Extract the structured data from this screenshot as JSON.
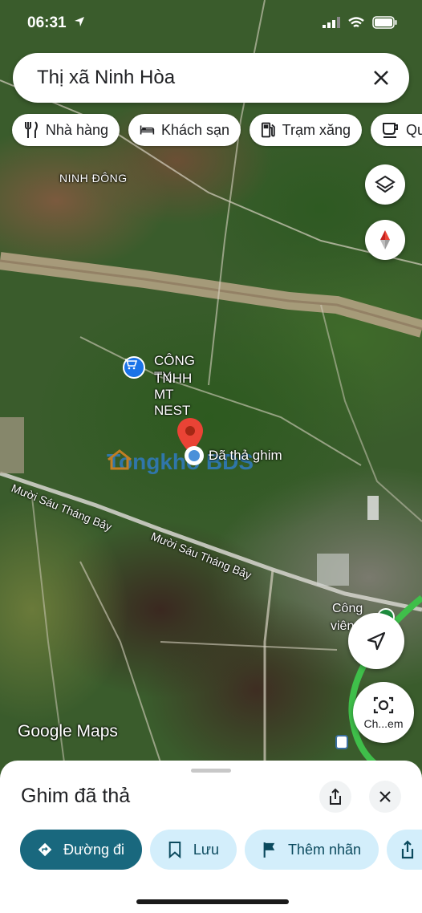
{
  "status_bar": {
    "time": "06:31"
  },
  "search": {
    "query": "Thị xã Ninh Hòa"
  },
  "chips": [
    {
      "label": "Nhà hàng",
      "icon": "fork-knife-icon"
    },
    {
      "label": "Khách sạn",
      "icon": "bed-icon"
    },
    {
      "label": "Trạm xăng",
      "icon": "gas-pump-icon"
    },
    {
      "label": "Qu",
      "icon": "coffee-cup-icon"
    }
  ],
  "map": {
    "labels": {
      "ninh_dong": "NINH ĐÔNG",
      "company_line1": "CÔNG TY",
      "company_line2": "TNHH MT NEST",
      "dropped_pin": "Đã thả ghim",
      "road1": "Mười Sáu Tháng Bảy",
      "road2": "Mười Sáu Tháng Bảy",
      "park_line1": "Công",
      "park_line2": "viên 16",
      "google_maps": "Google Maps",
      "watermark": "Tongkho BDS",
      "capture": "Ch...em"
    }
  },
  "sheet": {
    "title": "Ghim đã thả",
    "actions": [
      {
        "label": "Đường đi",
        "icon": "directions-icon"
      },
      {
        "label": "Lưu",
        "icon": "bookmark-icon"
      },
      {
        "label": "Thêm nhãn",
        "icon": "flag-icon"
      }
    ]
  }
}
